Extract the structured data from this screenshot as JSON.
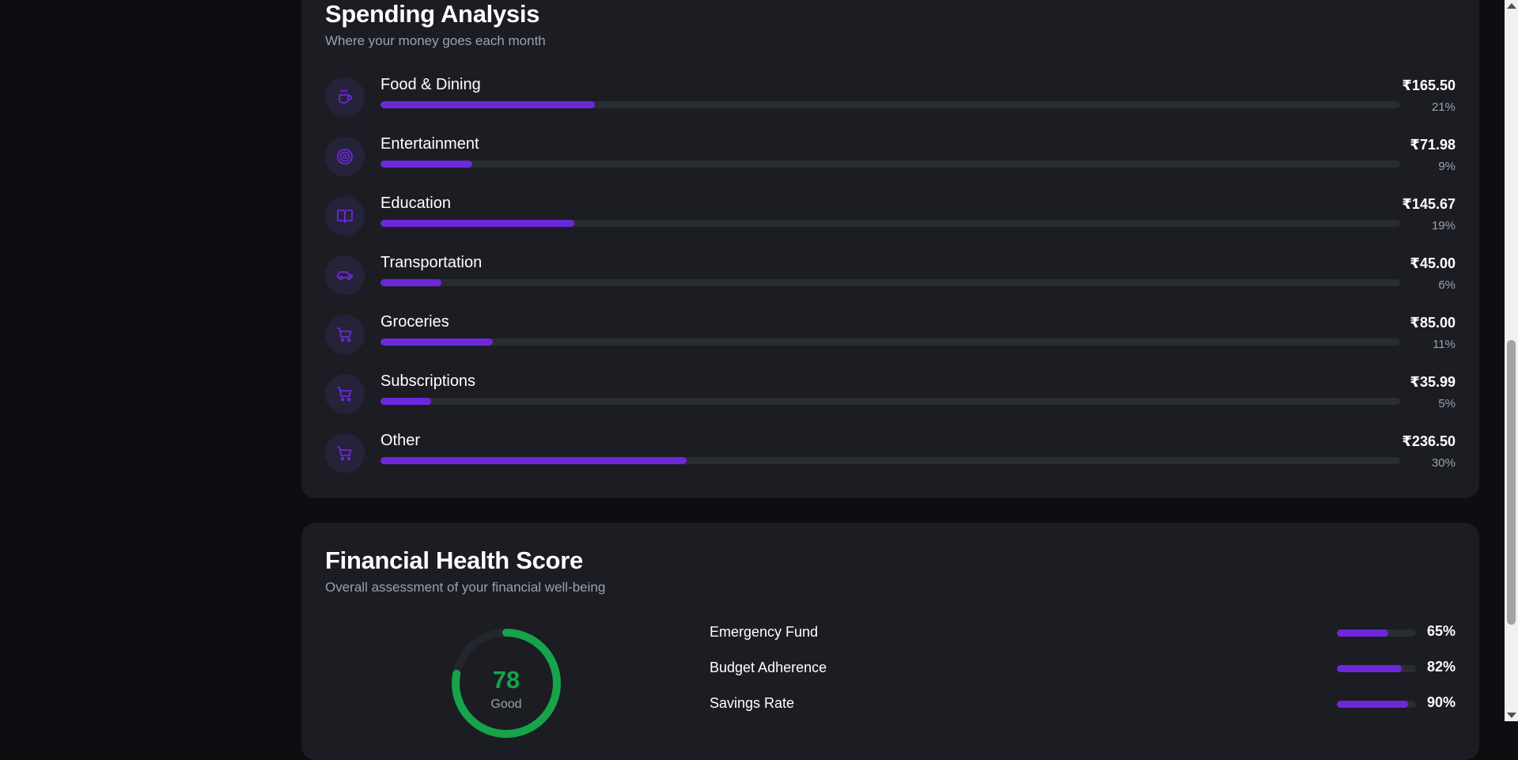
{
  "spending": {
    "title": "Spending Analysis",
    "subtitle": "Where your money goes each month",
    "accent_color": "#6d28d9",
    "categories": [
      {
        "name": "Food & Dining",
        "amount": "₹165.50",
        "percent_label": "21%",
        "percent": 21,
        "icon": "coffee-cup-icon"
      },
      {
        "name": "Entertainment",
        "amount": "₹71.98",
        "percent_label": "9%",
        "percent": 9,
        "icon": "target-icon"
      },
      {
        "name": "Education",
        "amount": "₹145.67",
        "percent_label": "19%",
        "percent": 19,
        "icon": "open-book-icon"
      },
      {
        "name": "Transportation",
        "amount": "₹45.00",
        "percent_label": "6%",
        "percent": 6,
        "icon": "car-icon"
      },
      {
        "name": "Groceries",
        "amount": "₹85.00",
        "percent_label": "11%",
        "percent": 11,
        "icon": "shopping-cart-icon"
      },
      {
        "name": "Subscriptions",
        "amount": "₹35.99",
        "percent_label": "5%",
        "percent": 5,
        "icon": "shopping-cart-icon"
      },
      {
        "name": "Other",
        "amount": "₹236.50",
        "percent_label": "30%",
        "percent": 30,
        "icon": "shopping-cart-icon"
      }
    ]
  },
  "health": {
    "title": "Financial Health Score",
    "subtitle": "Overall assessment of your financial well-being",
    "score": "78",
    "score_value": 78,
    "rating": "Good",
    "score_color": "#16a34a",
    "metrics": [
      {
        "name": "Emergency Fund",
        "value_label": "65%",
        "value": 65
      },
      {
        "name": "Budget Adherence",
        "value_label": "82%",
        "value": 82
      },
      {
        "name": "Savings Rate",
        "value_label": "90%",
        "value": 90
      }
    ]
  }
}
